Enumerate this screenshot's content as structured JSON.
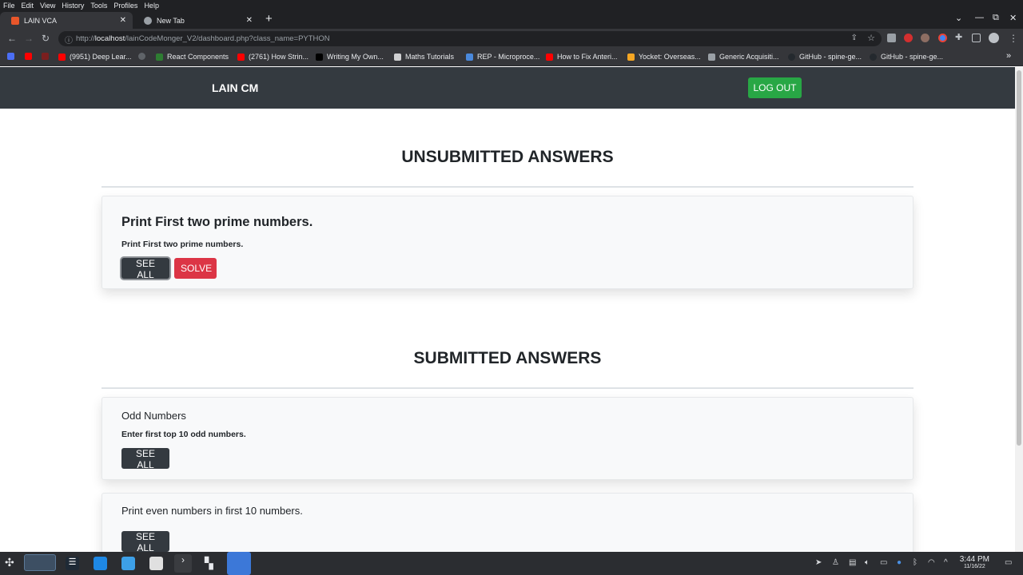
{
  "os_menu": [
    "File",
    "Edit",
    "View",
    "History",
    "Tools",
    "Profiles",
    "Help"
  ],
  "tabs": [
    {
      "title": "LAIN VCA",
      "favicon_color": "#e8562a"
    },
    {
      "title": "New Tab",
      "favicon_color": "#9aa0a6"
    }
  ],
  "address_bar": {
    "prefix": "http://",
    "host": "localhost",
    "path": "/lainCodeMonger_V2/dashboard.php?class_name=PYTHON"
  },
  "bookmarks": [
    {
      "label": "",
      "color": "#4b6ef5"
    },
    {
      "label": "",
      "color": "#ff0000"
    },
    {
      "label": "",
      "color": "#7a1f1f"
    },
    {
      "label": "(9951) Deep Lear...",
      "color": "#ff0000"
    },
    {
      "label": "",
      "color": "#5f6368"
    },
    {
      "label": "React Components",
      "color": "#2e7d32"
    },
    {
      "label": "(2761) How Strin...",
      "color": "#ff0000"
    },
    {
      "label": "Writing My Own...",
      "color": "#000000"
    },
    {
      "label": "Maths Tutorials",
      "color": "#cfd0d2"
    },
    {
      "label": "REP - Microproce...",
      "color": "#4a89dc"
    },
    {
      "label": "How to Fix Anteri...",
      "color": "#ff0000"
    },
    {
      "label": "Yocket: Overseas...",
      "color": "#f5a623"
    },
    {
      "label": "Generic Acquisiti...",
      "color": "#9aa0a6"
    },
    {
      "label": "GitHub - spine-ge...",
      "color": "#24292e"
    },
    {
      "label": "GitHub - spine-ge...",
      "color": "#24292e"
    }
  ],
  "app": {
    "brand": "LAIN CM",
    "logout_label": "LOG OUT",
    "unsubmitted_title": "UNSUBMITTED ANSWERS",
    "submitted_title": "SUBMITTED ANSWERS",
    "unsubmitted": [
      {
        "title": "Print First two prime numbers.",
        "description": "Print First two prime numbers.",
        "see_all": "SEE ALL",
        "solve": "SOLVE"
      }
    ],
    "submitted": [
      {
        "title": "Odd Numbers",
        "description": "Enter first top 10 odd numbers.",
        "see_all": "SEE ALL"
      },
      {
        "title": "Print even numbers in first 10 numbers.",
        "description": "",
        "see_all": "SEE ALL"
      }
    ]
  },
  "taskbar": {
    "time": "3:44 PM",
    "date": "11/16/22"
  },
  "colors": {
    "navbar": "#343a40",
    "success": "#28a745",
    "danger": "#dc3545",
    "dark_button": "#343a40"
  }
}
